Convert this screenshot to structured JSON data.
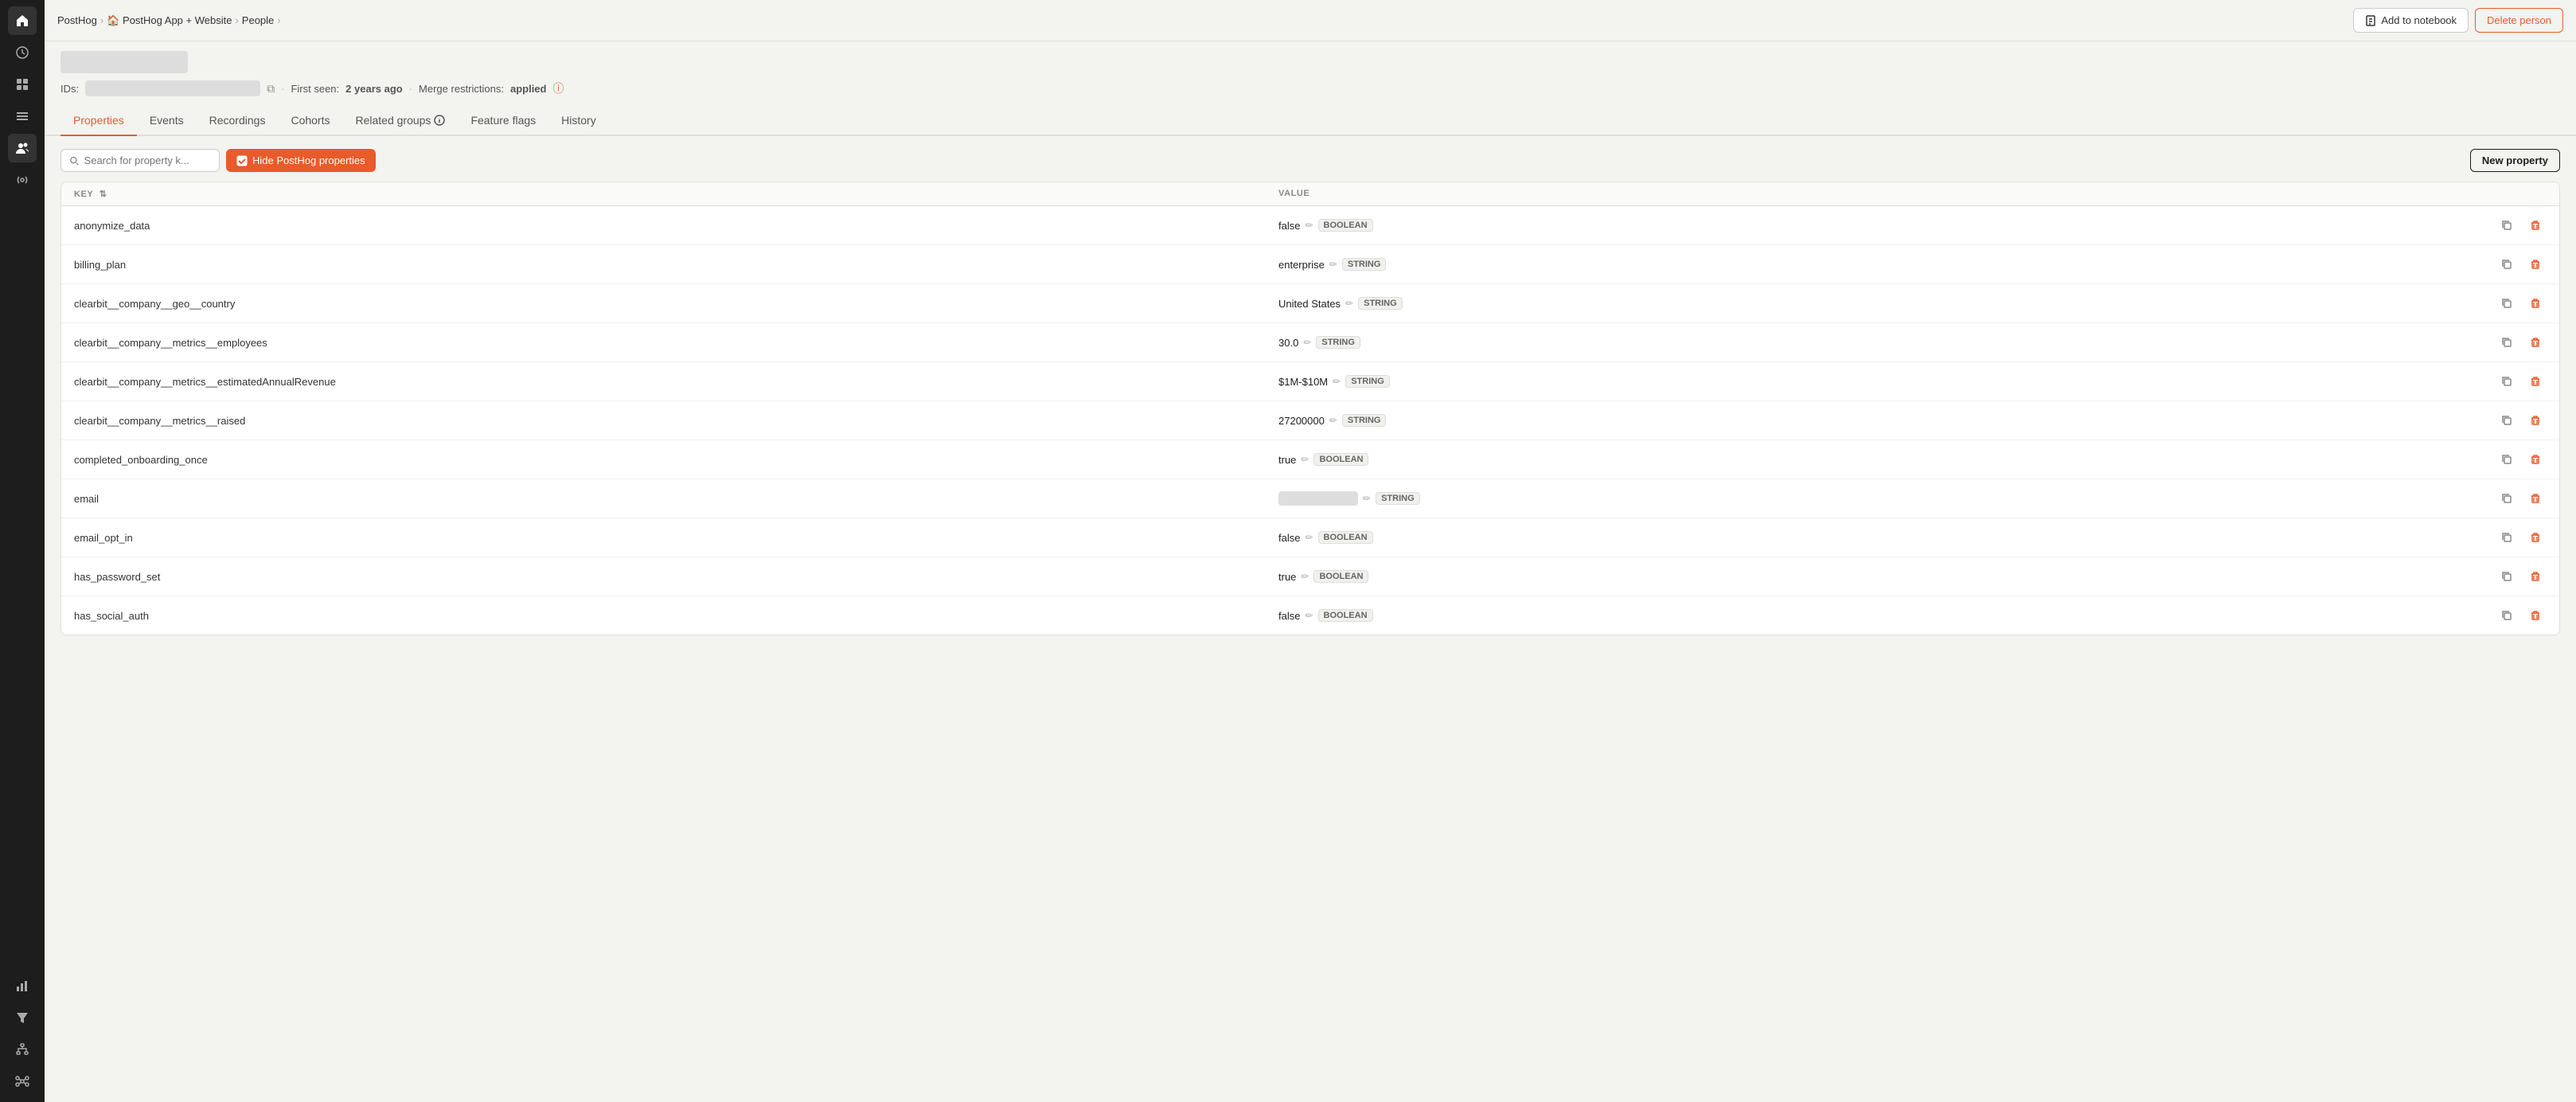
{
  "app": {
    "title": "PostHog"
  },
  "breadcrumb": {
    "items": [
      "PostHog",
      "PostHog App + Website",
      "People",
      ""
    ]
  },
  "topbar": {
    "add_to_notebook": "Add to notebook",
    "delete_person": "Delete person"
  },
  "person": {
    "name_redacted": true,
    "ids_label": "IDs:",
    "first_seen_label": "First seen:",
    "first_seen_value": "2 years ago",
    "merge_label": "Merge restrictions:",
    "merge_value": "applied"
  },
  "tabs": [
    {
      "id": "properties",
      "label": "Properties",
      "active": true
    },
    {
      "id": "events",
      "label": "Events",
      "active": false
    },
    {
      "id": "recordings",
      "label": "Recordings",
      "active": false
    },
    {
      "id": "cohorts",
      "label": "Cohorts",
      "active": false
    },
    {
      "id": "related-groups",
      "label": "Related groups",
      "active": false,
      "has_info": true
    },
    {
      "id": "feature-flags",
      "label": "Feature flags",
      "active": false
    },
    {
      "id": "history",
      "label": "History",
      "active": false
    }
  ],
  "toolbar": {
    "search_placeholder": "Search for property k...",
    "filter_label": "Hide PostHog properties",
    "new_property": "New property"
  },
  "table": {
    "col_key": "KEY",
    "col_value": "VALUE",
    "rows": [
      {
        "key": "anonymize_data",
        "value": "false",
        "type": "BOOLEAN",
        "redacted": false
      },
      {
        "key": "billing_plan",
        "value": "enterprise",
        "type": "STRING",
        "redacted": false
      },
      {
        "key": "clearbit__company__geo__country",
        "value": "United States",
        "type": "STRING",
        "redacted": false
      },
      {
        "key": "clearbit__company__metrics__employees",
        "value": "30.0",
        "type": "STRING",
        "redacted": false
      },
      {
        "key": "clearbit__company__metrics__estimatedAnnualRevenue",
        "value": "$1M-$10M",
        "type": "STRING",
        "redacted": false
      },
      {
        "key": "clearbit__company__metrics__raised",
        "value": "27200000",
        "type": "STRING",
        "redacted": false
      },
      {
        "key": "completed_onboarding_once",
        "value": "true",
        "type": "BOOLEAN",
        "redacted": false
      },
      {
        "key": "email",
        "value": "",
        "type": "STRING",
        "redacted": true
      },
      {
        "key": "email_opt_in",
        "value": "false",
        "type": "BOOLEAN",
        "redacted": false
      },
      {
        "key": "has_password_set",
        "value": "true",
        "type": "BOOLEAN",
        "redacted": false
      },
      {
        "key": "has_social_auth",
        "value": "false",
        "type": "BOOLEAN",
        "redacted": false
      }
    ]
  },
  "sidebar": {
    "icons": [
      {
        "name": "home",
        "symbol": "⌂",
        "active": false
      },
      {
        "name": "activity",
        "symbol": "↻",
        "active": false
      },
      {
        "name": "data",
        "symbol": "⊞",
        "active": false
      },
      {
        "name": "list",
        "symbol": "≡",
        "active": false
      },
      {
        "name": "people",
        "symbol": "●",
        "active": true
      },
      {
        "name": "signal",
        "symbol": "((·))",
        "active": false
      },
      {
        "name": "chart",
        "symbol": "▦",
        "active": false
      },
      {
        "name": "funnel",
        "symbol": "⌒",
        "active": false
      },
      {
        "name": "replay",
        "symbol": "▶",
        "active": false
      },
      {
        "name": "toggle",
        "symbol": "⬤",
        "active": false
      },
      {
        "name": "lab",
        "symbol": "⚗",
        "active": false
      },
      {
        "name": "message",
        "symbol": "▭",
        "active": false
      },
      {
        "name": "rocket",
        "symbol": "🚀",
        "active": false
      },
      {
        "name": "billing",
        "symbol": "▤",
        "active": false
      },
      {
        "name": "hierarchy",
        "symbol": "⑂",
        "active": false
      },
      {
        "name": "nodes",
        "symbol": "⑃",
        "active": false
      }
    ]
  }
}
